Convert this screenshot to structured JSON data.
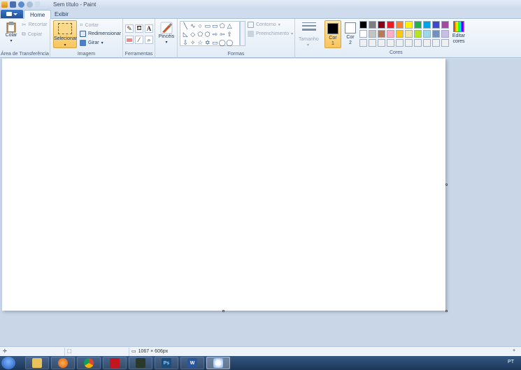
{
  "window": {
    "title": "Sem título - Paint"
  },
  "tabs": [
    {
      "label": "Home"
    },
    {
      "label": "Exibir"
    }
  ],
  "ribbon": {
    "clipboard": {
      "paste": "Colar",
      "cut": "Recortar",
      "copy": "Copiar",
      "label": "Área de Transferência"
    },
    "image": {
      "select": "Selecionar",
      "crop": "Cortar",
      "resize": "Redimensionar",
      "rotate": "Girar",
      "label": "Imagem"
    },
    "tools": {
      "label": "Ferramentas",
      "text_glyph": "A"
    },
    "brushes": {
      "label": "Pincéis"
    },
    "shapes": {
      "outline": "Contorno",
      "fill": "Preenchimento",
      "label": "Formas",
      "glyphs": [
        "╲",
        "∿",
        "○",
        "▭",
        "▭",
        "⬠",
        "△",
        "",
        "◺",
        "◇",
        "⬠",
        "⬡",
        "⇨",
        "⇦",
        "⇧",
        "",
        "⇩",
        "✧",
        "☆",
        "✡",
        "▭",
        "◯",
        "◯",
        ""
      ]
    },
    "size": {
      "label": "Tamanho"
    },
    "colors": {
      "color1_line1": "Cor",
      "color1_line2": "1",
      "color2_line1": "Cor",
      "color2_line2": "2",
      "edit_line1": "Editar",
      "edit_line2": "cores",
      "label": "Cores",
      "color1_value": "#000000",
      "color2_value": "#ffffff",
      "palette": [
        "#000000",
        "#7f7f7f",
        "#880015",
        "#ed1c24",
        "#ff7f27",
        "#fff200",
        "#22b14c",
        "#00a2e8",
        "#3f48cc",
        "#a349a4",
        "#ffffff",
        "#c3c3c3",
        "#b97a57",
        "#ffaec9",
        "#ffc90e",
        "#efe4b0",
        "#b5e61d",
        "#99d9ea",
        "#7092be",
        "#c8bfe7",
        "#f0f0f0",
        "#f0f0f0",
        "#f0f0f0",
        "#f0f0f0",
        "#f0f0f0",
        "#f0f0f0",
        "#f0f0f0",
        "#f0f0f0",
        "#f0f0f0",
        "#f0f0f0"
      ]
    }
  },
  "status": {
    "dimensions": "1067 × 606px"
  },
  "taskbar": {
    "language": "PT",
    "photoshop_label": "Ps",
    "word_label": "W"
  }
}
